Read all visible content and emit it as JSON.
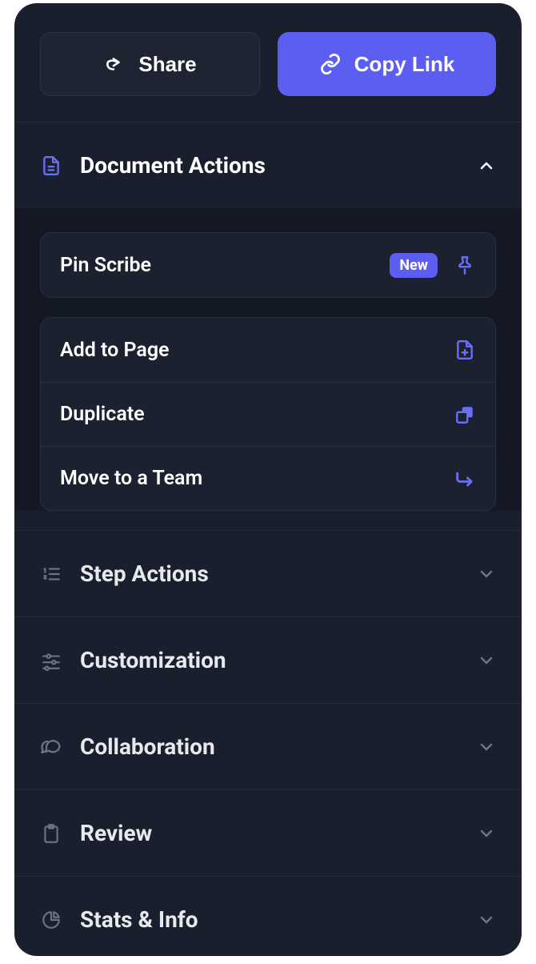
{
  "buttons": {
    "share": "Share",
    "copy_link": "Copy Link"
  },
  "sections": {
    "document_actions": {
      "title": "Document Actions",
      "items": {
        "pin_scribe": {
          "label": "Pin Scribe",
          "badge": "New"
        },
        "add_to_page": {
          "label": "Add to Page"
        },
        "duplicate": {
          "label": "Duplicate"
        },
        "move_to_team": {
          "label": "Move to a Team"
        }
      }
    },
    "step_actions": {
      "title": "Step Actions"
    },
    "customization": {
      "title": "Customization"
    },
    "collaboration": {
      "title": "Collaboration"
    },
    "review": {
      "title": "Review"
    },
    "stats_info": {
      "title": "Stats & Info"
    }
  }
}
